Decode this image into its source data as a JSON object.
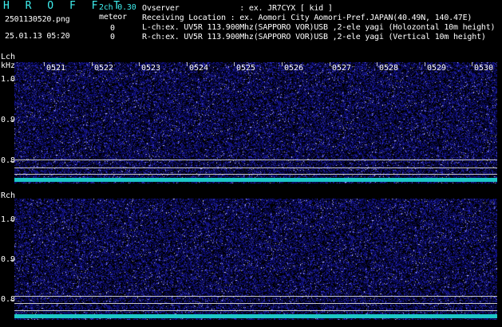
{
  "header": {
    "brand": "H R O F F T",
    "filename": "2501130520.png",
    "datetime": "25.01.13 05:20",
    "mode": "2ch 0.30",
    "meteor_label": "meteor",
    "count_l": "0",
    "count_r": "0",
    "observer": "Ovserver             : ex. JR7CYX [ kid ]",
    "location": "Receiving Location : ex. Aomori City Aomori-Pref.JAPAN(40.49N, 140.47E)",
    "lch_info": "L-ch:ex. UV5R 113.900Mhz(SAPPORO VOR)USB ,2-ele yagi (Holozontal 10m height)",
    "rch_info": "R-ch:ex. UV5R 113.900Mhz(SAPPORO VOR)USB ,2-ele yagi (Vertical 10m height)"
  },
  "lch": {
    "label": "Lch",
    "unit": "kHz",
    "yticks": [
      "1.0",
      "0.9",
      "0.8"
    ]
  },
  "rch": {
    "label": "Rch",
    "yticks": [
      "1.0",
      "0.9",
      "0.8"
    ]
  },
  "time_labels": [
    "0521",
    "0522",
    "0523",
    "0524",
    "0525",
    "0526",
    "0527",
    "0528",
    "0529",
    "0530"
  ],
  "colors": {
    "background": "#000000",
    "noise": "#1818a8",
    "accent": "#3ff0f0",
    "line": "#c8c8c8"
  }
}
